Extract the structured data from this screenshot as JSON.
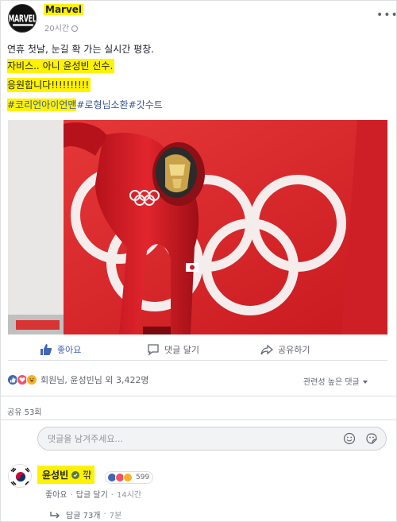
{
  "post": {
    "page_name": "Marvel",
    "avatar_text": "MARVEL",
    "timestamp": "20시간",
    "more_icon": "ellipsis-icon",
    "text_line1": "연휴 첫날, 눈길 확 가는 실시간 평창.",
    "text_line2": "자비스.. 아니 윤성빈 선수.",
    "text_line3": "응원합니다!!!!!!!!!!",
    "hashtags": [
      "#코리언아이언맨",
      "#로형님소환",
      "#갓수트"
    ]
  },
  "actions": {
    "like_label": "좋아요",
    "comment_label": "댓글 달기",
    "share_label": "공유하기"
  },
  "summary": {
    "reaction_text": "회원님, 윤성빈님 외 3,422명",
    "sort_label": "관련성 높은 댓글",
    "shares_text": "공유 53회"
  },
  "comment_input": {
    "placeholder": "댓글을 남겨주세요..."
  },
  "comment": {
    "author": "윤성빈",
    "text": "꺆",
    "reaction_count": "599",
    "like_link": "좋아요",
    "reply_link": "답글 달기",
    "time": "14시간",
    "replies_label": "답글 73개",
    "replies_time": "7분"
  },
  "colors": {
    "highlight": "#fff200",
    "link": "#385898",
    "like": "#4267b2",
    "photo_red": "#d6232b"
  }
}
